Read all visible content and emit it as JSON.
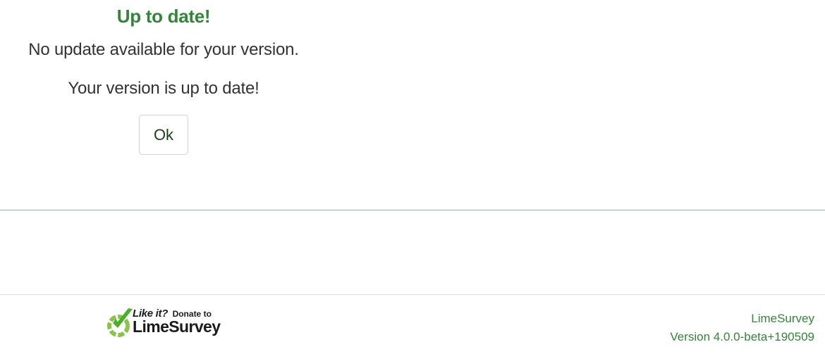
{
  "update_panel": {
    "title": "Up to date!",
    "message": "No update available for your version.",
    "status": "Your version is up to date!",
    "ok_label": "Ok"
  },
  "footer": {
    "donate": {
      "line1_like": "Like it?",
      "line1_donate": "Donate to",
      "brand": "LimeSurvey",
      "icon": "limesurvey-logo-icon"
    },
    "app_name": "LimeSurvey",
    "version": "Version 4.0.0-beta+190509"
  },
  "colors": {
    "accent": "#328637",
    "logo_green": "#8bc34a"
  }
}
